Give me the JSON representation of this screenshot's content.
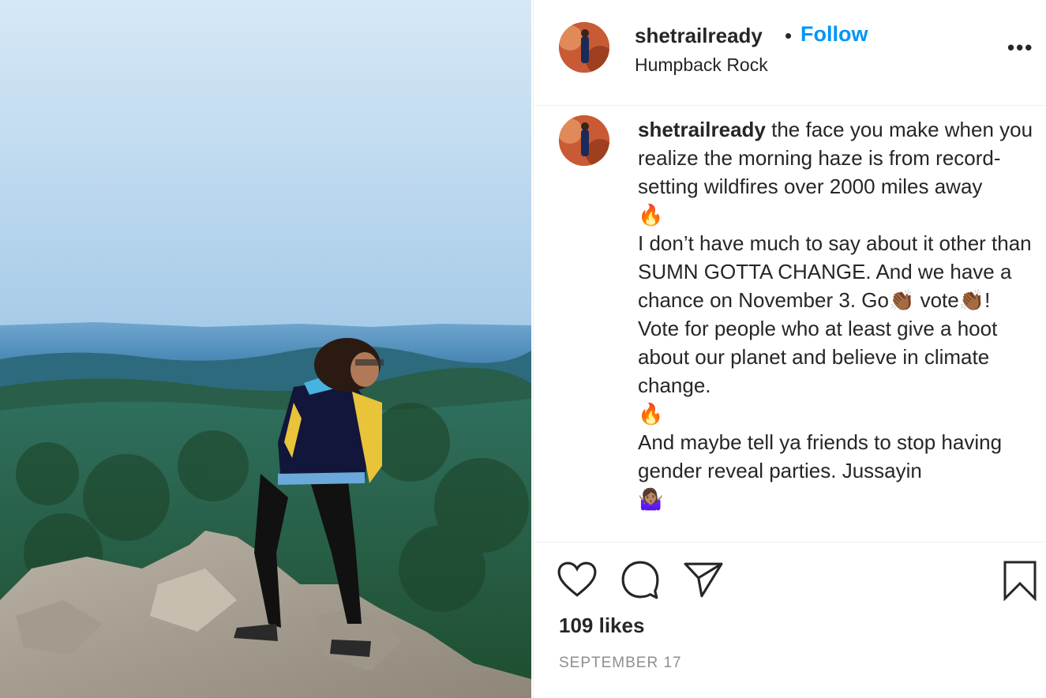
{
  "post": {
    "username": "shetrailready",
    "separator": "•",
    "follow_label": "Follow",
    "location": "Humpback Rock",
    "more_label": "•••",
    "photo_icon": "hiker-on-mountain-photo"
  },
  "caption": {
    "username": "shetrailready",
    "line1_text": " the face you make when you realize the morning haze is from record-setting wildfires over 2000 miles away",
    "fire_emoji": "🔥",
    "para2_a": "I don’t have much to say about it other than SUMN GOTTA CHANGE. And we have a chance on November 3. Go",
    "para2_b": " vote",
    "para2_c": "! Vote for people who at least give a hoot about our planet and believe in climate change.",
    "para3": "And maybe tell ya friends to stop having gender reveal parties. Jussayin",
    "clap_emoji": "👏🏾",
    "shrug_emoji": "🤷🏽‍♀️"
  },
  "actions": {
    "like_icon": "heart-icon",
    "comment_icon": "comment-icon",
    "share_icon": "paper-plane-icon",
    "save_icon": "bookmark-icon",
    "likes": "109 likes",
    "date": "SEPTEMBER 17"
  },
  "colors": {
    "accent": "#0095f6",
    "text": "#262626",
    "muted": "#8e8e8e",
    "divider": "#efefef"
  }
}
